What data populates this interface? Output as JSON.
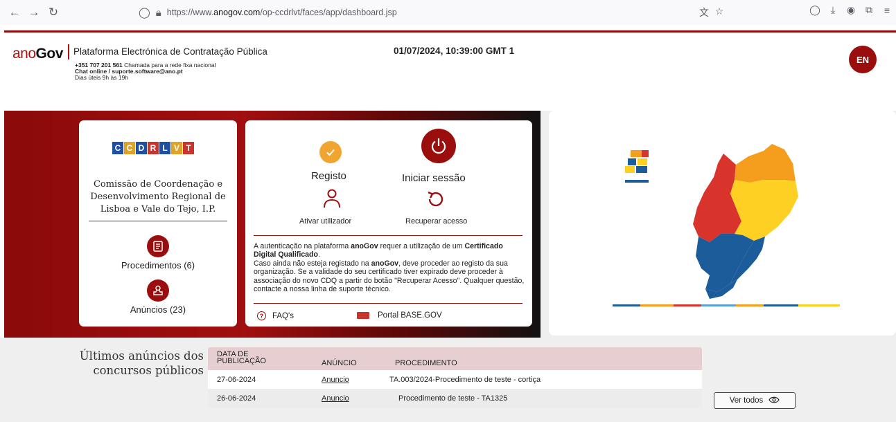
{
  "browser": {
    "url_prefix": "https://www.",
    "url_domain": "anogov.com",
    "url_path": "/op-ccdrlvt/faces/app/dashboard.jsp"
  },
  "header": {
    "logo_ano": "ano",
    "logo_gov": "Gov",
    "platform_title": "Plataforma Electrónica de Contratação Pública",
    "phone": "+351 707 201 561",
    "phone_note": "Chamada para a rede fixa nacional",
    "chat": "Chat online / suporte.software@ano.pt",
    "hours": "Dias úteis 9h às 19h",
    "datetime": "01/07/2024, 10:39:00 GMT 1",
    "lang_button": "EN"
  },
  "org_card": {
    "logo_letters": [
      "C",
      "C",
      "D",
      "R",
      "L",
      "V",
      "T"
    ],
    "logo_colors": [
      "#1f4fa3",
      "#e0a32a",
      "#1f4fa3",
      "#c8352e",
      "#1f4fa3",
      "#e0a32a",
      "#c8352e"
    ],
    "name_line1": "Comissão de Coordenação e",
    "name_line2": "Desenvolvimento Regional de",
    "name_line3": "Lisboa e Vale do Tejo, I.P.",
    "procedures_label": "Procedimentos (6)",
    "announcements_label": "Anúncios (23)"
  },
  "auth_card": {
    "register_label": "Registo",
    "login_label": "Iniciar sessão",
    "activate_label": "Ativar utilizador",
    "recover_label": "Recuperar acesso",
    "text_p1_a": "A autenticação na plataforma ",
    "text_p1_b": "anoGov",
    "text_p1_c": " requer a utilização de um ",
    "text_p1_d": "Certificado Digital Qualificado",
    "text_p1_e": ".",
    "text_p2_a": "Caso ainda não esteja registado na ",
    "text_p2_b": "anoGov",
    "text_p2_c": ", deve proceder ao registo da sua organização. Se a validade do seu certificado tiver expirado deve proceder à associação do novo CDQ a partir do botão \"Recuperar Acesso\". Qualquer questão, contacte a nossa linha de suporte técnico.",
    "faq_label": "FAQ's",
    "base_label": "Portal BASE.GOV"
  },
  "announcements": {
    "title_line1": "Últimos anúncios dos",
    "title_line2": "concursos públicos",
    "col_date_1": "DATA DE",
    "col_date_2": "PUBLICAÇÃO",
    "col_ann": "ANÚNCIO",
    "col_proc": "PROCEDIMENTO",
    "rows": [
      {
        "date": "27-06-2024",
        "link": "Anuncio",
        "procedure": "TA.003/2024-Procedimento de teste - cortiça"
      },
      {
        "date": "26-06-2024",
        "link": "Anuncio",
        "procedure": "Procedimento de teste - TA1325"
      }
    ],
    "view_all": "Ver todos"
  },
  "colors": {
    "brand_red": "#9b0e0e",
    "accent_orange": "#f0a530",
    "map_red": "#d9342b",
    "map_orange": "#f59d1d",
    "map_yellow": "#fdd023",
    "map_blue": "#1d5c9b"
  }
}
